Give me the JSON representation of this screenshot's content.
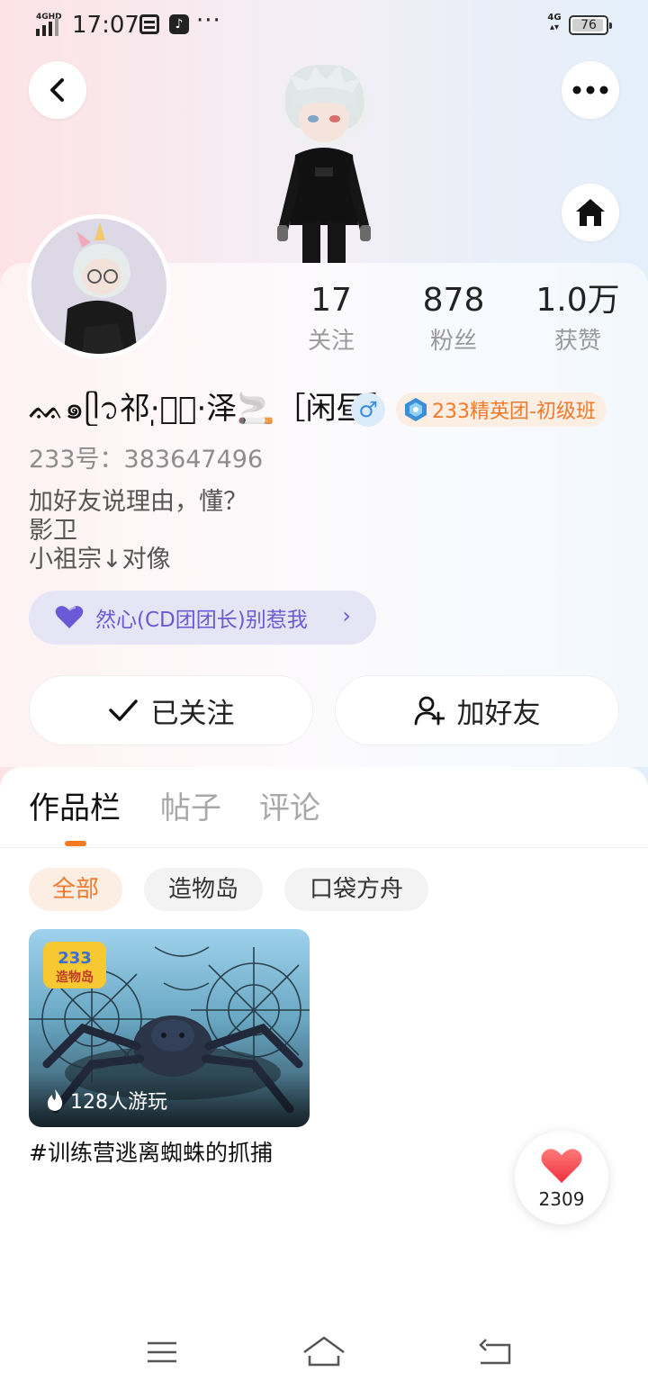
{
  "status_bar": {
    "network_gen": "4GHD",
    "time": "17:07",
    "more": "···",
    "net_right": "4G",
    "battery": "76"
  },
  "profile": {
    "username": "ᨐ๑ᥫ᭡祁·̩͙⃝·泽🚬［闲昼］",
    "gender": "♂",
    "rank_badge": "233精英团-初级班",
    "uid": "233号：383647496",
    "bio": [
      "加好友说理由，懂？",
      "影卫",
      "小祖宗↓对像"
    ],
    "team": "然心(CD团团长)别惹我",
    "team_chevron": "›"
  },
  "stats": [
    {
      "value": "17",
      "label": "关注"
    },
    {
      "value": "878",
      "label": "粉丝"
    },
    {
      "value": "1.0万",
      "label": "获赞"
    }
  ],
  "actions": {
    "follow_label": "已关注",
    "add_friend_label": "加好友"
  },
  "tabs": [
    {
      "label": "作品栏",
      "active": true
    },
    {
      "label": "帖子",
      "active": false
    },
    {
      "label": "评论",
      "active": false
    }
  ],
  "filters": [
    {
      "label": "全部",
      "active": true
    },
    {
      "label": "造物岛",
      "active": false
    },
    {
      "label": "口袋方舟",
      "active": false
    }
  ],
  "works": [
    {
      "plays": "128人游玩",
      "title": "#训练营逃离蜘蛛的抓捕",
      "logo_text": "233造物岛"
    }
  ],
  "like_fab": {
    "count": "2309"
  },
  "colors": {
    "accent": "#f47a1f",
    "team_purple": "#6a5ad6",
    "gender_blue": "#3b8fe0"
  },
  "icons": [
    "back-icon",
    "more-icon",
    "home-icon",
    "check-icon",
    "add-user-icon",
    "heart-icon",
    "fire-icon",
    "menu-icon",
    "nav-home-icon",
    "nav-back-icon"
  ]
}
